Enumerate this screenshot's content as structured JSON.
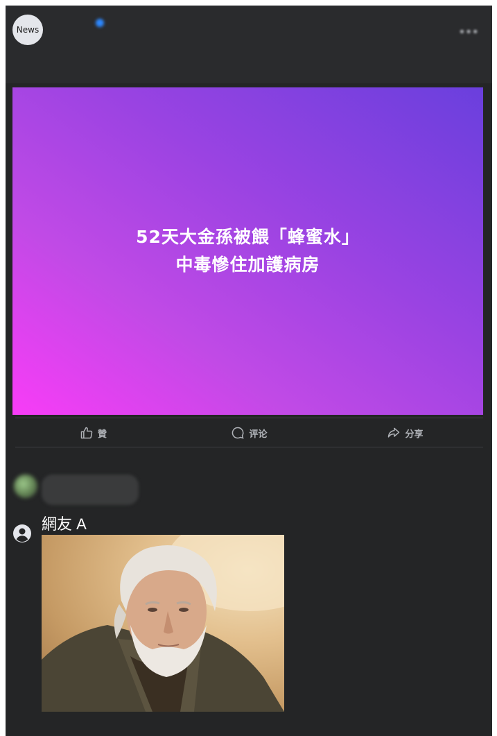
{
  "post": {
    "page_avatar_label": "News",
    "page_name": "",
    "meta": "",
    "caption_tag": "",
    "caption_text": "",
    "caption_link": ""
  },
  "headline": {
    "line1": "52天大金孫被餵「蜂蜜水」",
    "line2": "中毒慘住加護病房"
  },
  "actions": {
    "like": "贊",
    "comment": "评论",
    "share": "分享"
  },
  "comments": {
    "sort_label": "",
    "first_author": "",
    "first_text": "",
    "reply_author": "網友 A"
  },
  "colors": {
    "card_bg": "#242526",
    "gradient_start": "#f83cf7",
    "gradient_end": "#6a3fdd",
    "action_text": "#b0b3b8"
  }
}
